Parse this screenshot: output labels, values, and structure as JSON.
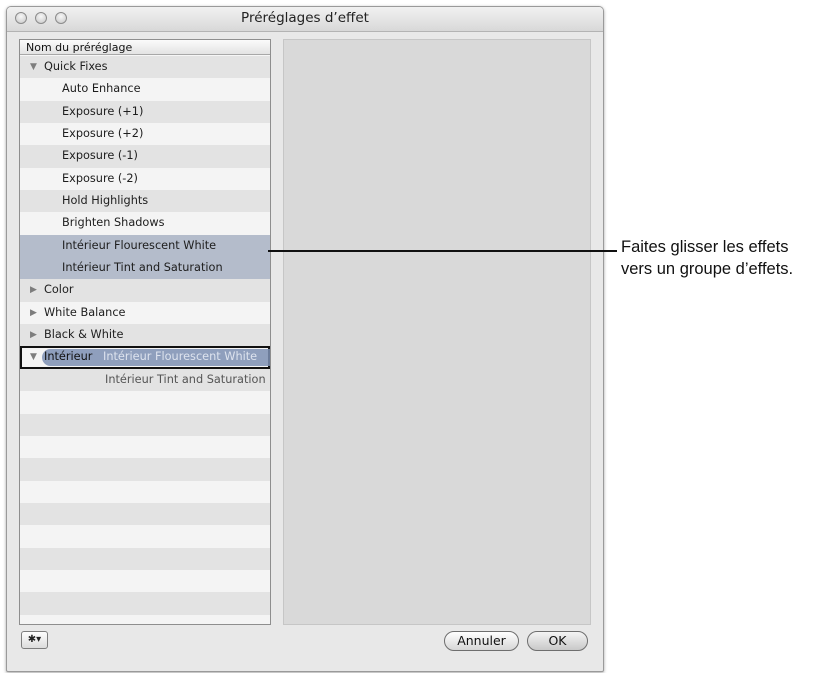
{
  "window": {
    "title": "Préréglages d’effet"
  },
  "list": {
    "header": "Nom du préréglage",
    "rows": [
      {
        "label": "Quick Fixes",
        "level": 0,
        "triangle": "▼"
      },
      {
        "label": "Auto Enhance",
        "level": 1
      },
      {
        "label": "Exposure (+1)",
        "level": 1
      },
      {
        "label": "Exposure (+2)",
        "level": 1
      },
      {
        "label": "Exposure (-1)",
        "level": 1
      },
      {
        "label": "Exposure (-2)",
        "level": 1
      },
      {
        "label": "Hold Highlights",
        "level": 1
      },
      {
        "label": "Brighten Shadows",
        "level": 1
      },
      {
        "label": "Intérieur Flourescent White",
        "level": 1,
        "selected": true
      },
      {
        "label": "Intérieur Tint and Saturation",
        "level": 1,
        "selected": true
      },
      {
        "label": "Color",
        "level": 0,
        "triangle": "▶"
      },
      {
        "label": "White Balance",
        "level": 0,
        "triangle": "▶"
      },
      {
        "label": "Black & White",
        "level": 0,
        "triangle": "▶"
      }
    ],
    "drop_target": {
      "label": "Intérieur",
      "triangle": "▼",
      "dragged_1": "Intérieur Flourescent White",
      "dragged_2": "Intérieur Tint and Saturation"
    }
  },
  "buttons": {
    "action_glyph": "✱▾",
    "cancel": "Annuler",
    "ok": "OK"
  },
  "callout": {
    "line1": "Faites glisser les effets",
    "line2": "vers un groupe d’effets."
  },
  "colors": {
    "selection": "#b4bccb",
    "drag_pill": "#7d8fb3"
  }
}
